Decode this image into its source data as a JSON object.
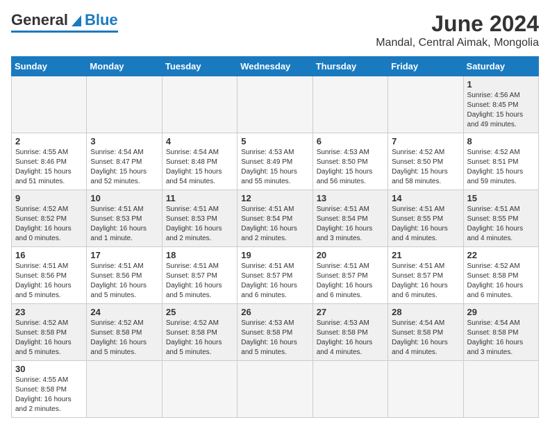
{
  "header": {
    "logo_general": "General",
    "logo_blue": "Blue",
    "title": "June 2024",
    "subtitle": "Mandal, Central Aimak, Mongolia"
  },
  "weekdays": [
    "Sunday",
    "Monday",
    "Tuesday",
    "Wednesday",
    "Thursday",
    "Friday",
    "Saturday"
  ],
  "weeks": [
    [
      {
        "day": "",
        "info": ""
      },
      {
        "day": "",
        "info": ""
      },
      {
        "day": "",
        "info": ""
      },
      {
        "day": "",
        "info": ""
      },
      {
        "day": "",
        "info": ""
      },
      {
        "day": "",
        "info": ""
      },
      {
        "day": "1",
        "info": "Sunrise: 4:56 AM\nSunset: 8:45 PM\nDaylight: 15 hours\nand 49 minutes."
      }
    ],
    [
      {
        "day": "2",
        "info": "Sunrise: 4:55 AM\nSunset: 8:46 PM\nDaylight: 15 hours\nand 51 minutes."
      },
      {
        "day": "3",
        "info": "Sunrise: 4:54 AM\nSunset: 8:47 PM\nDaylight: 15 hours\nand 52 minutes."
      },
      {
        "day": "4",
        "info": "Sunrise: 4:54 AM\nSunset: 8:48 PM\nDaylight: 15 hours\nand 54 minutes."
      },
      {
        "day": "5",
        "info": "Sunrise: 4:53 AM\nSunset: 8:49 PM\nDaylight: 15 hours\nand 55 minutes."
      },
      {
        "day": "6",
        "info": "Sunrise: 4:53 AM\nSunset: 8:50 PM\nDaylight: 15 hours\nand 56 minutes."
      },
      {
        "day": "7",
        "info": "Sunrise: 4:52 AM\nSunset: 8:50 PM\nDaylight: 15 hours\nand 58 minutes."
      },
      {
        "day": "8",
        "info": "Sunrise: 4:52 AM\nSunset: 8:51 PM\nDaylight: 15 hours\nand 59 minutes."
      }
    ],
    [
      {
        "day": "9",
        "info": "Sunrise: 4:52 AM\nSunset: 8:52 PM\nDaylight: 16 hours\nand 0 minutes."
      },
      {
        "day": "10",
        "info": "Sunrise: 4:51 AM\nSunset: 8:53 PM\nDaylight: 16 hours\nand 1 minute."
      },
      {
        "day": "11",
        "info": "Sunrise: 4:51 AM\nSunset: 8:53 PM\nDaylight: 16 hours\nand 2 minutes."
      },
      {
        "day": "12",
        "info": "Sunrise: 4:51 AM\nSunset: 8:54 PM\nDaylight: 16 hours\nand 2 minutes."
      },
      {
        "day": "13",
        "info": "Sunrise: 4:51 AM\nSunset: 8:54 PM\nDaylight: 16 hours\nand 3 minutes."
      },
      {
        "day": "14",
        "info": "Sunrise: 4:51 AM\nSunset: 8:55 PM\nDaylight: 16 hours\nand 4 minutes."
      },
      {
        "day": "15",
        "info": "Sunrise: 4:51 AM\nSunset: 8:55 PM\nDaylight: 16 hours\nand 4 minutes."
      }
    ],
    [
      {
        "day": "16",
        "info": "Sunrise: 4:51 AM\nSunset: 8:56 PM\nDaylight: 16 hours\nand 5 minutes."
      },
      {
        "day": "17",
        "info": "Sunrise: 4:51 AM\nSunset: 8:56 PM\nDaylight: 16 hours\nand 5 minutes."
      },
      {
        "day": "18",
        "info": "Sunrise: 4:51 AM\nSunset: 8:57 PM\nDaylight: 16 hours\nand 5 minutes."
      },
      {
        "day": "19",
        "info": "Sunrise: 4:51 AM\nSunset: 8:57 PM\nDaylight: 16 hours\nand 6 minutes."
      },
      {
        "day": "20",
        "info": "Sunrise: 4:51 AM\nSunset: 8:57 PM\nDaylight: 16 hours\nand 6 minutes."
      },
      {
        "day": "21",
        "info": "Sunrise: 4:51 AM\nSunset: 8:57 PM\nDaylight: 16 hours\nand 6 minutes."
      },
      {
        "day": "22",
        "info": "Sunrise: 4:52 AM\nSunset: 8:58 PM\nDaylight: 16 hours\nand 6 minutes."
      }
    ],
    [
      {
        "day": "23",
        "info": "Sunrise: 4:52 AM\nSunset: 8:58 PM\nDaylight: 16 hours\nand 5 minutes."
      },
      {
        "day": "24",
        "info": "Sunrise: 4:52 AM\nSunset: 8:58 PM\nDaylight: 16 hours\nand 5 minutes."
      },
      {
        "day": "25",
        "info": "Sunrise: 4:52 AM\nSunset: 8:58 PM\nDaylight: 16 hours\nand 5 minutes."
      },
      {
        "day": "26",
        "info": "Sunrise: 4:53 AM\nSunset: 8:58 PM\nDaylight: 16 hours\nand 5 minutes."
      },
      {
        "day": "27",
        "info": "Sunrise: 4:53 AM\nSunset: 8:58 PM\nDaylight: 16 hours\nand 4 minutes."
      },
      {
        "day": "28",
        "info": "Sunrise: 4:54 AM\nSunset: 8:58 PM\nDaylight: 16 hours\nand 4 minutes."
      },
      {
        "day": "29",
        "info": "Sunrise: 4:54 AM\nSunset: 8:58 PM\nDaylight: 16 hours\nand 3 minutes."
      }
    ],
    [
      {
        "day": "30",
        "info": "Sunrise: 4:55 AM\nSunset: 8:58 PM\nDaylight: 16 hours\nand 2 minutes."
      },
      {
        "day": "",
        "info": ""
      },
      {
        "day": "",
        "info": ""
      },
      {
        "day": "",
        "info": ""
      },
      {
        "day": "",
        "info": ""
      },
      {
        "day": "",
        "info": ""
      },
      {
        "day": "",
        "info": ""
      }
    ]
  ]
}
